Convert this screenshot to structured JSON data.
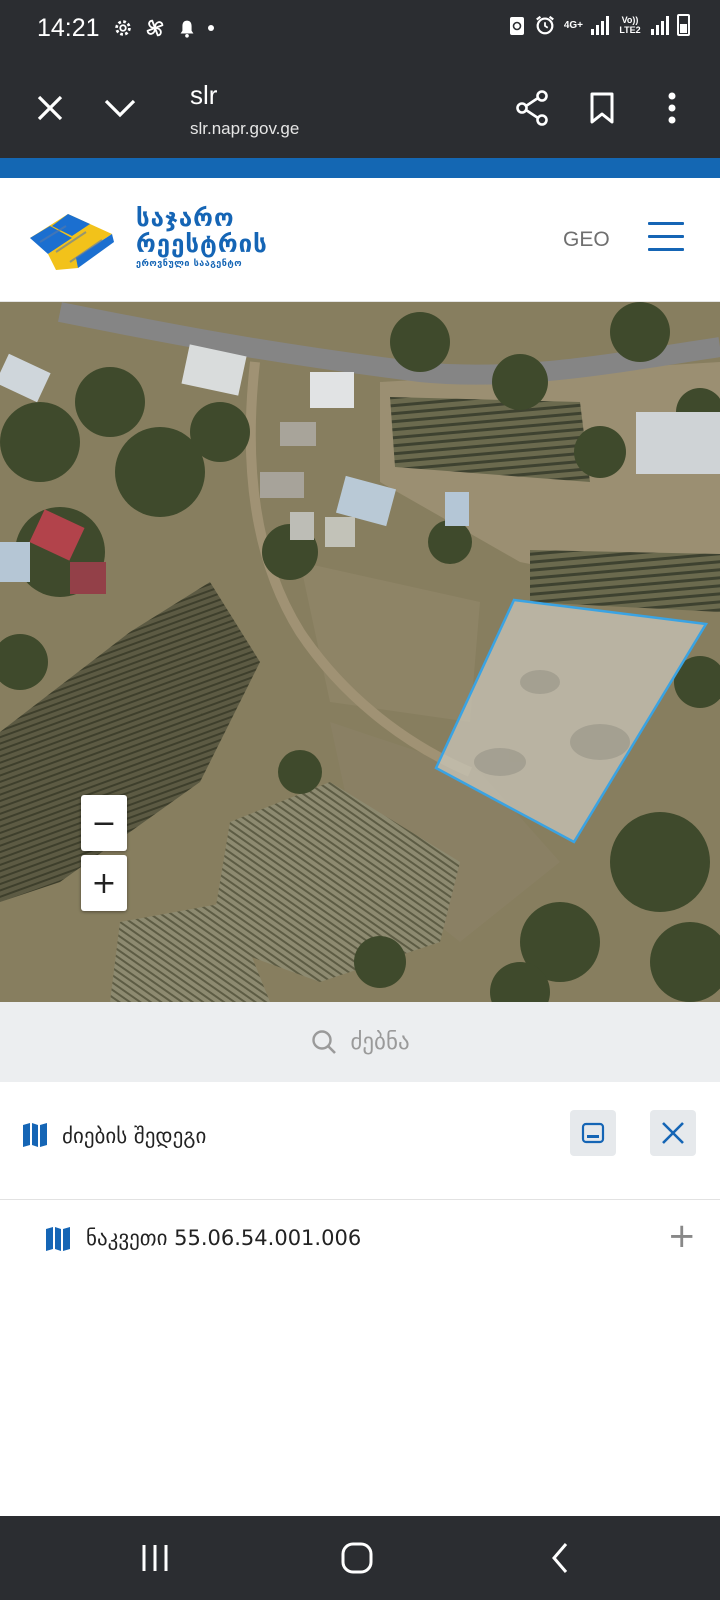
{
  "status_bar": {
    "time": "14:21",
    "network_label": "4G+",
    "carrier_label": "Vo)) LTE2"
  },
  "browser": {
    "title": "slr",
    "url": "slr.napr.gov.ge"
  },
  "site": {
    "logo_line1": "საჯარო",
    "logo_line2": "რეესტრის",
    "logo_line3": "ეროვნული სააგენტო",
    "language": "GEO"
  },
  "map": {
    "zoom_out": "−",
    "zoom_in": "+"
  },
  "search": {
    "label": "ძებნა"
  },
  "results": {
    "title": "ძიების შედეგი",
    "items": [
      {
        "label": "ნაკვეთი 55.06.54.001.006",
        "action": "+"
      }
    ]
  },
  "colors": {
    "brand_blue": "#1467b3",
    "parcel_outline": "#3aa3e3",
    "chrome_dark": "#2b2d31"
  }
}
